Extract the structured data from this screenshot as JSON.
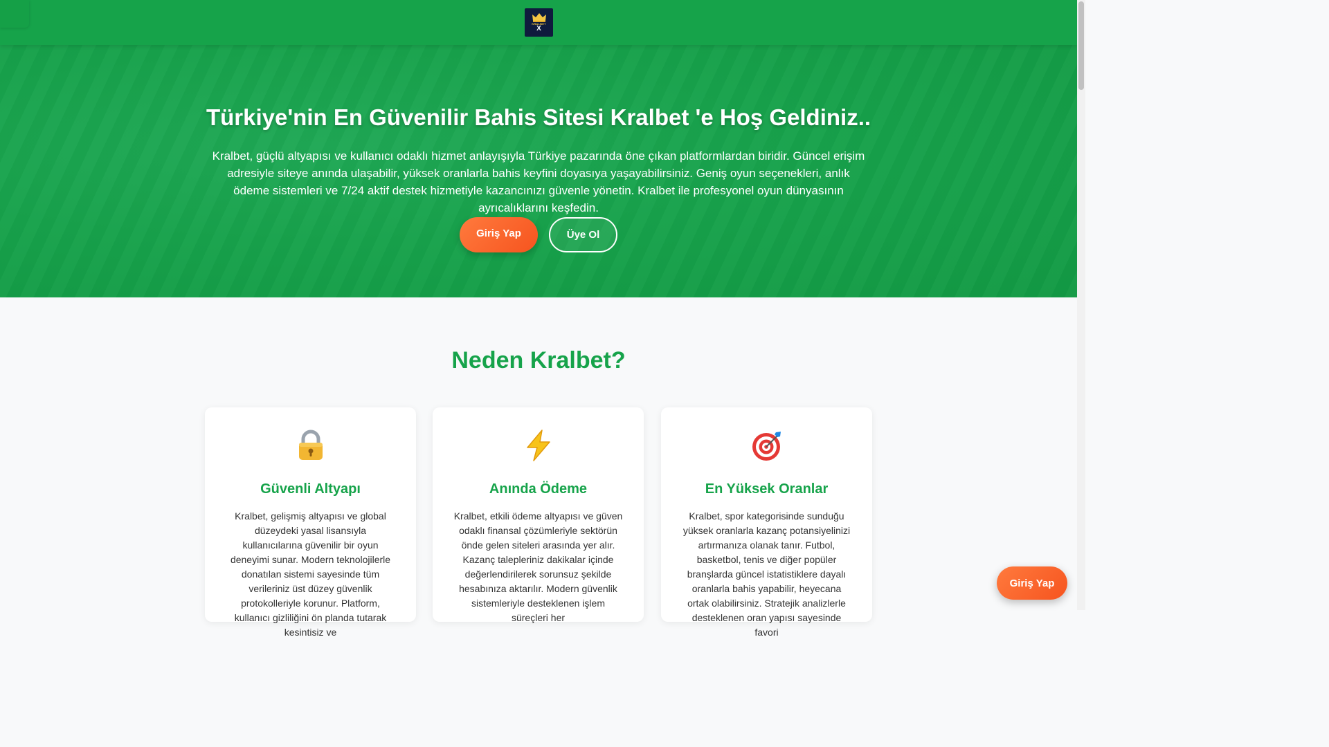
{
  "header": {
    "logo": {
      "brand": "KRALBET",
      "mark": "X"
    },
    "menu_icon": "menu-icon"
  },
  "hero": {
    "title": "Türkiye'nin En Güvenilir Bahis Sitesi Kralbet 'e Hoş Geldiniz..",
    "text": "Kralbet, güçlü altyapısı ve kullanıcı odaklı hizmet anlayışıyla Türkiye pazarında öne çıkan platformlardan biridir. Güncel erişim adresiyle siteye anında ulaşabilir, yüksek oranlarla bahis keyfini doyasıya yaşayabilirsiniz. Geniş oyun seçenekleri, anlık ödeme sistemleri ve 7/24 aktif destek hizmetiyle kazancınızı güvenle yönetin. Kralbet ile profesyonel oyun dünyasının ayrıcalıklarını keşfedin.",
    "login_label": "Giriş Yap",
    "register_label": "Üye Ol"
  },
  "features": {
    "title": "Neden Kralbet?",
    "cards": [
      {
        "icon": "lock-icon",
        "title": "Güvenli Altyapı",
        "text": "Kralbet, gelişmiş altyapısı ve global düzeydeki yasal lisansıyla kullanıcılarına güvenilir bir oyun deneyimi sunar. Modern teknolojilerle donatılan sistemi sayesinde tüm verileriniz üst düzey güvenlik protokolleriyle korunur. Platform, kullanıcı gizliliğini ön planda tutarak kesintisiz ve"
      },
      {
        "icon": "lightning-icon",
        "title": "Anında Ödeme",
        "text": "Kralbet, etkili ödeme altyapısı ve güven odaklı finansal çözümleriyle sektörün önde gelen siteleri arasında yer alır. Kazanç talepleriniz dakikalar içinde değerlendirilerek sorunsuz şekilde hesabınıza aktarılır. Modern güvenlik sistemleriyle desteklenen işlem süreçleri her"
      },
      {
        "icon": "target-icon",
        "title": "En Yüksek Oranlar",
        "text": "Kralbet, spor kategorisinde sunduğu yüksek oranlarla kazanç potansiyelinizi artırmanıza olanak tanır. Futbol, basketbol, tenis ve diğer popüler branşlarda güncel istatistiklere dayalı oranlarla bahis yapabilir, heyecana ortak olabilirsiniz. Stratejik analizlerle desteklenen oran yapısı sayesinde favori"
      }
    ]
  },
  "floating": {
    "login_label": "Giriş Yap"
  },
  "colors": {
    "primary": "#16a34a",
    "accent": "#f6541f",
    "logo_bg": "#0f1b3d"
  }
}
